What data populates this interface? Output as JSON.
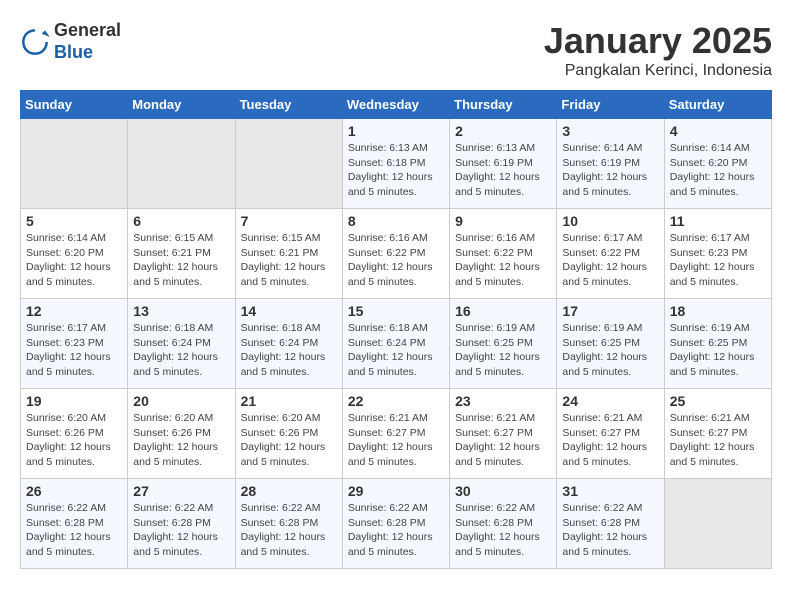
{
  "header": {
    "logo_general": "General",
    "logo_blue": "Blue",
    "title": "January 2025",
    "subtitle": "Pangkalan Kerinci, Indonesia"
  },
  "calendar": {
    "weekdays": [
      "Sunday",
      "Monday",
      "Tuesday",
      "Wednesday",
      "Thursday",
      "Friday",
      "Saturday"
    ],
    "weeks": [
      [
        {
          "num": "",
          "info": ""
        },
        {
          "num": "",
          "info": ""
        },
        {
          "num": "",
          "info": ""
        },
        {
          "num": "1",
          "info": "Sunrise: 6:13 AM\nSunset: 6:18 PM\nDaylight: 12 hours\nand 5 minutes."
        },
        {
          "num": "2",
          "info": "Sunrise: 6:13 AM\nSunset: 6:19 PM\nDaylight: 12 hours\nand 5 minutes."
        },
        {
          "num": "3",
          "info": "Sunrise: 6:14 AM\nSunset: 6:19 PM\nDaylight: 12 hours\nand 5 minutes."
        },
        {
          "num": "4",
          "info": "Sunrise: 6:14 AM\nSunset: 6:20 PM\nDaylight: 12 hours\nand 5 minutes."
        }
      ],
      [
        {
          "num": "5",
          "info": "Sunrise: 6:14 AM\nSunset: 6:20 PM\nDaylight: 12 hours\nand 5 minutes."
        },
        {
          "num": "6",
          "info": "Sunrise: 6:15 AM\nSunset: 6:21 PM\nDaylight: 12 hours\nand 5 minutes."
        },
        {
          "num": "7",
          "info": "Sunrise: 6:15 AM\nSunset: 6:21 PM\nDaylight: 12 hours\nand 5 minutes."
        },
        {
          "num": "8",
          "info": "Sunrise: 6:16 AM\nSunset: 6:22 PM\nDaylight: 12 hours\nand 5 minutes."
        },
        {
          "num": "9",
          "info": "Sunrise: 6:16 AM\nSunset: 6:22 PM\nDaylight: 12 hours\nand 5 minutes."
        },
        {
          "num": "10",
          "info": "Sunrise: 6:17 AM\nSunset: 6:22 PM\nDaylight: 12 hours\nand 5 minutes."
        },
        {
          "num": "11",
          "info": "Sunrise: 6:17 AM\nSunset: 6:23 PM\nDaylight: 12 hours\nand 5 minutes."
        }
      ],
      [
        {
          "num": "12",
          "info": "Sunrise: 6:17 AM\nSunset: 6:23 PM\nDaylight: 12 hours\nand 5 minutes."
        },
        {
          "num": "13",
          "info": "Sunrise: 6:18 AM\nSunset: 6:24 PM\nDaylight: 12 hours\nand 5 minutes."
        },
        {
          "num": "14",
          "info": "Sunrise: 6:18 AM\nSunset: 6:24 PM\nDaylight: 12 hours\nand 5 minutes."
        },
        {
          "num": "15",
          "info": "Sunrise: 6:18 AM\nSunset: 6:24 PM\nDaylight: 12 hours\nand 5 minutes."
        },
        {
          "num": "16",
          "info": "Sunrise: 6:19 AM\nSunset: 6:25 PM\nDaylight: 12 hours\nand 5 minutes."
        },
        {
          "num": "17",
          "info": "Sunrise: 6:19 AM\nSunset: 6:25 PM\nDaylight: 12 hours\nand 5 minutes."
        },
        {
          "num": "18",
          "info": "Sunrise: 6:19 AM\nSunset: 6:25 PM\nDaylight: 12 hours\nand 5 minutes."
        }
      ],
      [
        {
          "num": "19",
          "info": "Sunrise: 6:20 AM\nSunset: 6:26 PM\nDaylight: 12 hours\nand 5 minutes."
        },
        {
          "num": "20",
          "info": "Sunrise: 6:20 AM\nSunset: 6:26 PM\nDaylight: 12 hours\nand 5 minutes."
        },
        {
          "num": "21",
          "info": "Sunrise: 6:20 AM\nSunset: 6:26 PM\nDaylight: 12 hours\nand 5 minutes."
        },
        {
          "num": "22",
          "info": "Sunrise: 6:21 AM\nSunset: 6:27 PM\nDaylight: 12 hours\nand 5 minutes."
        },
        {
          "num": "23",
          "info": "Sunrise: 6:21 AM\nSunset: 6:27 PM\nDaylight: 12 hours\nand 5 minutes."
        },
        {
          "num": "24",
          "info": "Sunrise: 6:21 AM\nSunset: 6:27 PM\nDaylight: 12 hours\nand 5 minutes."
        },
        {
          "num": "25",
          "info": "Sunrise: 6:21 AM\nSunset: 6:27 PM\nDaylight: 12 hours\nand 5 minutes."
        }
      ],
      [
        {
          "num": "26",
          "info": "Sunrise: 6:22 AM\nSunset: 6:28 PM\nDaylight: 12 hours\nand 5 minutes."
        },
        {
          "num": "27",
          "info": "Sunrise: 6:22 AM\nSunset: 6:28 PM\nDaylight: 12 hours\nand 5 minutes."
        },
        {
          "num": "28",
          "info": "Sunrise: 6:22 AM\nSunset: 6:28 PM\nDaylight: 12 hours\nand 5 minutes."
        },
        {
          "num": "29",
          "info": "Sunrise: 6:22 AM\nSunset: 6:28 PM\nDaylight: 12 hours\nand 5 minutes."
        },
        {
          "num": "30",
          "info": "Sunrise: 6:22 AM\nSunset: 6:28 PM\nDaylight: 12 hours\nand 5 minutes."
        },
        {
          "num": "31",
          "info": "Sunrise: 6:22 AM\nSunset: 6:28 PM\nDaylight: 12 hours\nand 5 minutes."
        },
        {
          "num": "",
          "info": ""
        }
      ]
    ]
  }
}
